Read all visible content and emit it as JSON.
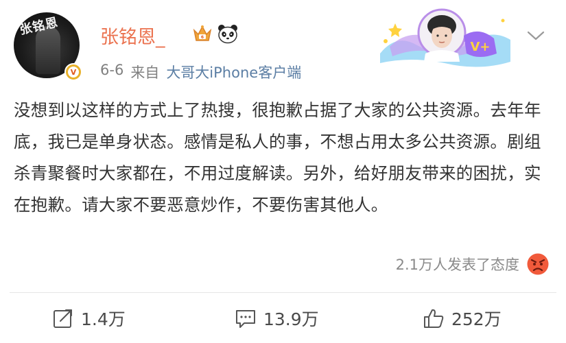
{
  "user": {
    "name": "张铭恩_",
    "avatar_overlay_text": "张铭恩"
  },
  "post": {
    "date": "6-6",
    "source_prefix": "来自",
    "source": "大哥大iPhone客户端",
    "body": "没想到以这样的方式上了热搜，很抱歉占据了大家的公共资源。去年年底，我已是单身状态。感情是私人的事，不想占用太多公共资源。剧组杀青聚餐时大家都在，不用过度解读。另外，给好朋友带来的困扰，实在抱歉。请大家不要恶意炒作，不要伤害其他人。",
    "attitude_text": "2.1万人发表了态度"
  },
  "banner": {
    "badge_text": "V+"
  },
  "actions": {
    "repost_count": "1.4万",
    "comment_count": "13.9万",
    "like_count": "252万"
  },
  "colors": {
    "username": "#eb7350",
    "link": "#5b7ea4",
    "meta": "#808080",
    "body": "#333333"
  },
  "icons": {
    "crown": "crown-icon",
    "panda": "panda-icon",
    "chevron": "chevron-down-icon",
    "angry": "angry-face-icon",
    "repost": "repost-icon",
    "comment": "comment-icon",
    "like": "thumbs-up-icon"
  }
}
